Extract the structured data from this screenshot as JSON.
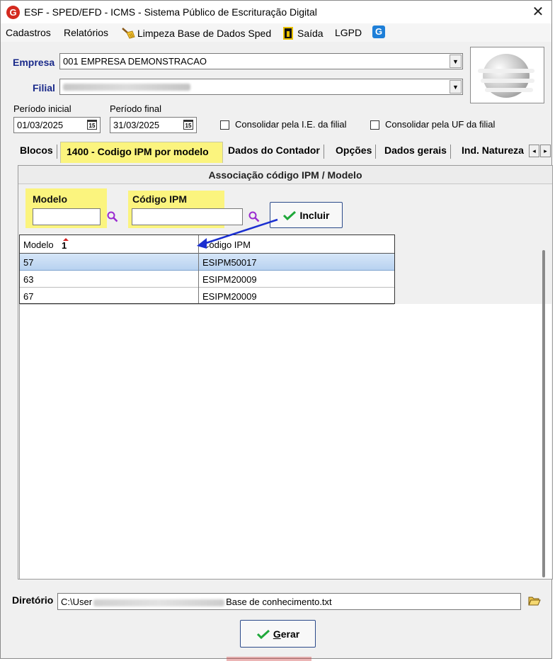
{
  "window": {
    "title": "ESF - SPED/EFD - ICMS - Sistema Público de Escrituração Digital",
    "logo_letter": "G",
    "close_glyph": "✕"
  },
  "menu": {
    "items": [
      "Cadastros",
      "Relatórios",
      "Limpeza Base de Dados Sped",
      "Saída",
      "LGPD"
    ],
    "icons": [
      "broom-icon",
      "exit-door-icon",
      "g-brand-icon"
    ]
  },
  "form": {
    "empresa_label": "Empresa",
    "empresa_value": "001 EMPRESA DEMONSTRACAO",
    "filial_label": "Filial",
    "periodo_inicial_label": "Período inicial",
    "periodo_inicial_value": "01/03/2025",
    "periodo_final_label": "Período final",
    "periodo_final_value": "31/03/2025",
    "calendar_glyph": "15",
    "consolidar_ie_label": "Consolidar pela I.E. da filial",
    "consolidar_uf_label": "Consolidar pela UF da filial"
  },
  "tabs": {
    "items": [
      "Blocos",
      "1400 - Codigo IPM por modelo",
      "Dados do Contador",
      "Opções",
      "Dados gerais",
      "Ind. Natureza"
    ],
    "active_index": 1,
    "scroll_left": "◂",
    "scroll_right": "▸"
  },
  "panel": {
    "header": "Associação código IPM / Modelo",
    "modelo_label": "Modelo",
    "codigo_label": "Código IPM",
    "include_label": "Incluir",
    "highlight_color": "#fbf47e"
  },
  "grid": {
    "columns": [
      "Modelo",
      "Código IPM"
    ],
    "sort_glyph": "1",
    "rows": [
      {
        "modelo": "57",
        "codigo": "ESIPM50017"
      },
      {
        "modelo": "63",
        "codigo": "ESIPM20009"
      },
      {
        "modelo": "67",
        "codigo": "ESIPM20009"
      }
    ],
    "selected_row": 0
  },
  "directory": {
    "label": "Diretório",
    "value_prefix": "C:\\User",
    "value_suffix": "Base de conhecimento.txt"
  },
  "actions": {
    "gerar_label": "Gerar"
  }
}
